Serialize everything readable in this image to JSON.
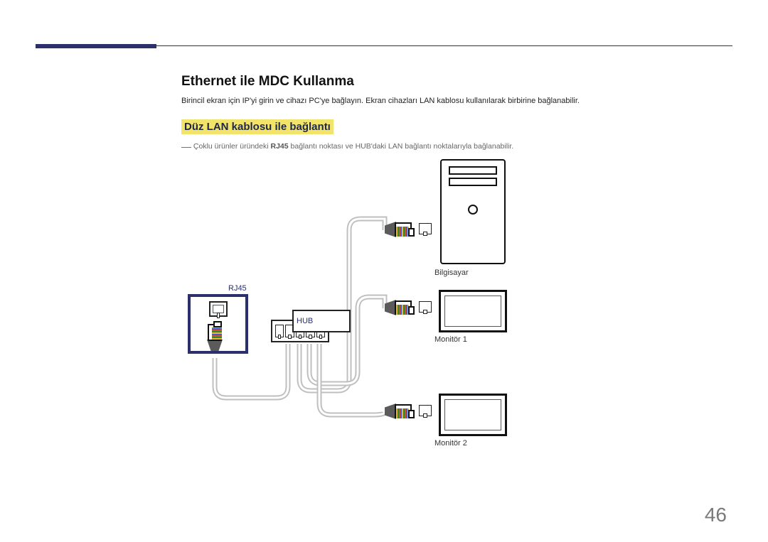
{
  "page_number": "46",
  "section_title": "Ethernet ile MDC Kullanma",
  "intro_text": "Birincil ekran için IP'yi girin ve cihazı PC'ye bağlayın. Ekran cihazları LAN kablosu kullanılarak birbirine bağlanabilir.",
  "subsection_title": "Düz LAN kablosu ile bağlantı",
  "note_dash": "―",
  "note_prefix": "Çoklu ürünler üründeki ",
  "note_bold": "RJ45",
  "note_suffix": " bağlantı noktası ve HUB'daki LAN bağlantı noktalarıyla bağlanabilir.",
  "labels": {
    "rj45": "RJ45",
    "hub": "HUB",
    "computer": "Bilgisayar",
    "monitor1": "Monitör 1",
    "monitor2": "Monitör 2"
  }
}
